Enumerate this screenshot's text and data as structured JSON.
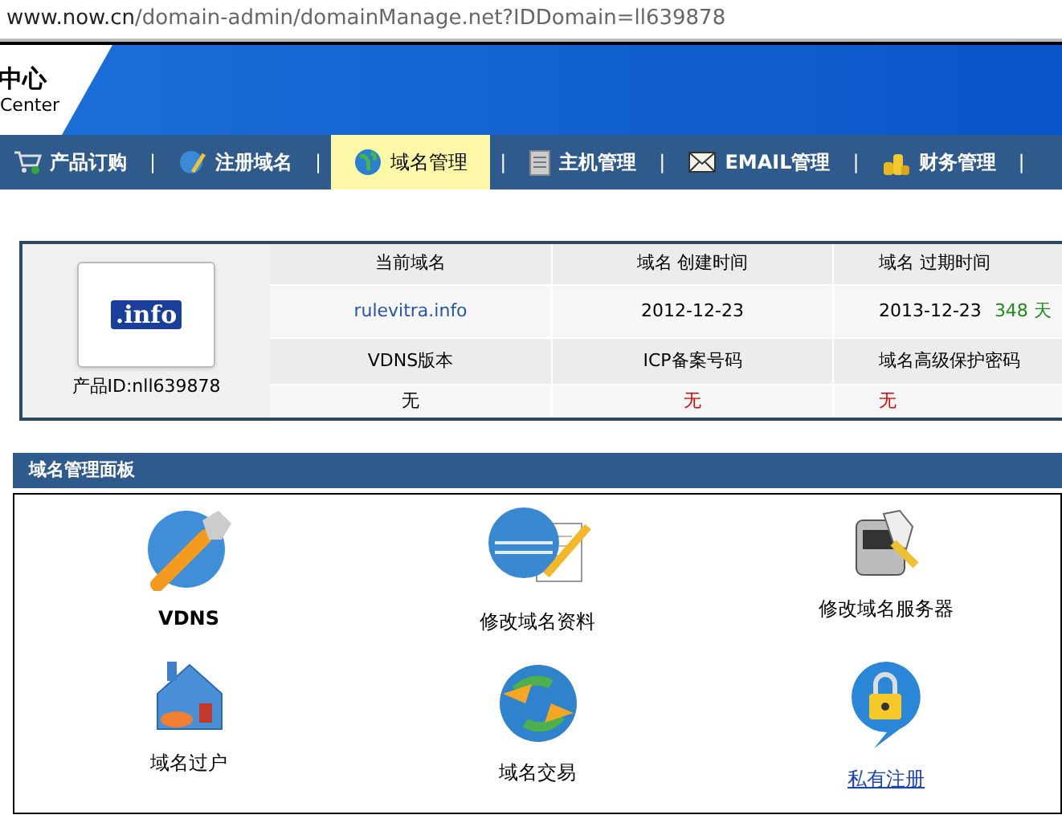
{
  "address_bar": {
    "host": "www.now.cn",
    "path": "/domain-admin/domainManage.net?IDDomain=ll639878"
  },
  "header": {
    "title": "中心",
    "subtitle": "Center"
  },
  "nav": [
    {
      "label": "产品订购",
      "selected": false
    },
    {
      "label": "注册域名",
      "selected": false
    },
    {
      "label": "域名管理",
      "selected": true
    },
    {
      "label": "主机管理",
      "selected": false
    },
    {
      "label": "EMAIL管理",
      "selected": false
    },
    {
      "label": "财务管理",
      "selected": false
    }
  ],
  "nav_separator": "|",
  "product": {
    "logo_text": ".info",
    "product_id": "产品ID:nll639878"
  },
  "info_rows": [
    {
      "kind": "header",
      "cells": [
        {
          "text": "当前域名"
        },
        {
          "text": "域名 创建时间"
        },
        {
          "text": "域名 过期时间"
        }
      ]
    },
    {
      "kind": "value",
      "cells": [
        {
          "text": "rulevitra.info",
          "link": true
        },
        {
          "text": "2012-12-23"
        },
        {
          "text": "2013-12-23",
          "extra": "348 天"
        }
      ]
    },
    {
      "kind": "header",
      "cells": [
        {
          "text": "VDNS版本"
        },
        {
          "text": "ICP备案号码"
        },
        {
          "text": "域名高级保护密码"
        }
      ]
    },
    {
      "kind": "value",
      "cells": [
        {
          "text": "无",
          "alert": false
        },
        {
          "text": "无",
          "alert": true
        },
        {
          "text": "无",
          "alert": true
        }
      ]
    }
  ],
  "panel": {
    "title": "域名管理面板",
    "items": [
      {
        "label": "VDNS",
        "kind": "bold"
      },
      {
        "label": "修改域名资料",
        "kind": "plain"
      },
      {
        "label": "修改域名服务器",
        "kind": "plain"
      },
      {
        "label": "域名过户",
        "kind": "plain"
      },
      {
        "label": "域名交易",
        "kind": "plain"
      },
      {
        "label": "私有注册",
        "kind": "link"
      }
    ]
  }
}
